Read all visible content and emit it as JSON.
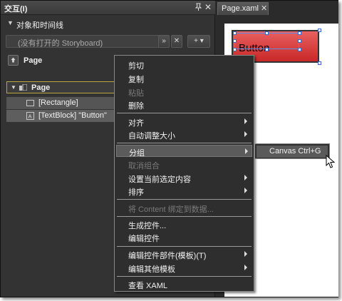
{
  "panel": {
    "title": "交互(I)",
    "section_title": "对象和时间线",
    "storyboard_placeholder": "(没有打开的 Storyboard)",
    "add_button": "+ ▾",
    "scope_label": "Page"
  },
  "tree": {
    "items": [
      {
        "label": "Page"
      },
      {
        "label": "[Rectangle]"
      },
      {
        "label": "[TextBlock] \"Button\""
      }
    ]
  },
  "document": {
    "tab_label": "Page.xaml",
    "button_text": "Button"
  },
  "menu": {
    "items": [
      {
        "label": "剪切"
      },
      {
        "label": "复制"
      },
      {
        "label": "粘贴"
      },
      {
        "label": "删除"
      },
      {
        "label": "对齐"
      },
      {
        "label": "自动调整大小"
      },
      {
        "label": "分组"
      },
      {
        "label": "取消组合"
      },
      {
        "label": "设置当前选定内容"
      },
      {
        "label": "排序"
      },
      {
        "label": "将 Content 绑定到数据..."
      },
      {
        "label": "生成控件..."
      },
      {
        "label": "编辑控件"
      },
      {
        "label": "编辑控件部件(模板)(T)"
      },
      {
        "label": "编辑其他模板"
      },
      {
        "label": "查看 XAML"
      }
    ]
  },
  "submenu": {
    "label": "Canvas  Ctrl+G"
  },
  "colors": {
    "panel_bg": "#333333",
    "menu_bg": "#2e2e2e",
    "highlight": "#5b5b5b",
    "selection_border": "#b8a642",
    "button_red": "#d63a3a",
    "selection_blue": "#5a8ee6"
  }
}
